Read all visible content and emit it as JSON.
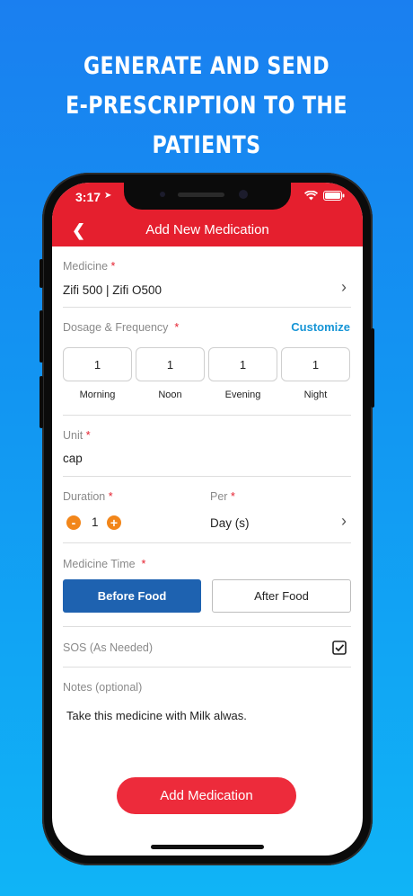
{
  "promo": {
    "line1": "GENERATE AND SEND",
    "line2": "E-PRESCRIPTION TO THE PATIENTS"
  },
  "status_bar": {
    "time": "3:17"
  },
  "header": {
    "title": "Add New Medication",
    "back_icon": "chevron-left-icon"
  },
  "medicine": {
    "label": "Medicine",
    "value": "Zifi 500 | Zifi O500"
  },
  "dosage": {
    "label": "Dosage & Frequency",
    "customize": "Customize",
    "slots": [
      {
        "value": "1",
        "label": "Morning"
      },
      {
        "value": "1",
        "label": "Noon"
      },
      {
        "value": "1",
        "label": "Evening"
      },
      {
        "value": "1",
        "label": "Night"
      }
    ]
  },
  "unit": {
    "label": "Unit",
    "value": "cap"
  },
  "duration": {
    "label": "Duration",
    "value": "1",
    "minus": "-",
    "plus": "+"
  },
  "per": {
    "label": "Per",
    "value": "Day (s)"
  },
  "medicine_time": {
    "label": "Medicine Time",
    "before": "Before Food",
    "after": "After Food"
  },
  "sos": {
    "label": "SOS (As Needed)",
    "checked": true
  },
  "notes": {
    "label": "Notes (optional)",
    "value": "Take this medicine with Milk alwas."
  },
  "actions": {
    "add": "Add Medication"
  },
  "colors": {
    "brand_red": "#e51f2e",
    "accent_blue": "#1e62b0",
    "link_blue": "#1695d6",
    "stepper_orange": "#f2861a"
  },
  "required_mark": "*"
}
